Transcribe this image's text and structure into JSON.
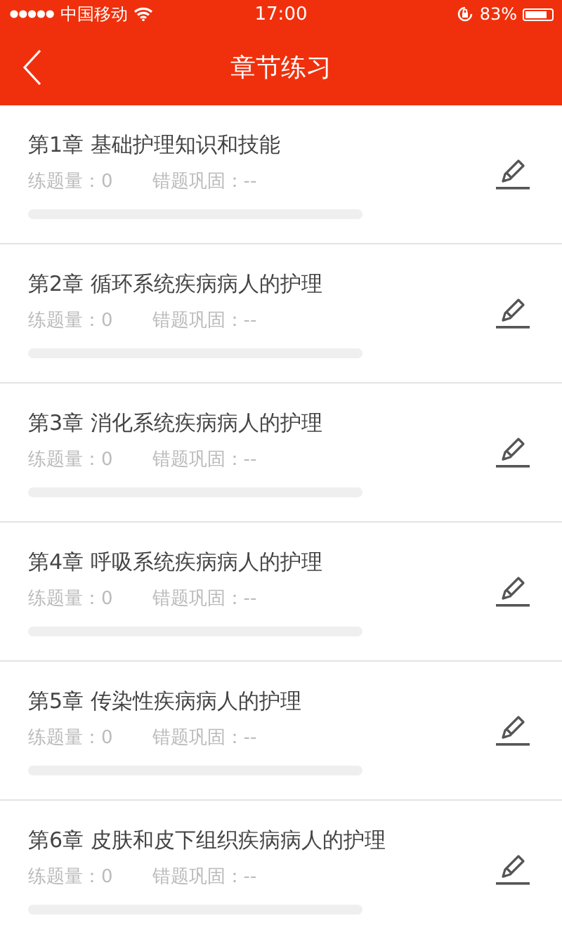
{
  "status_bar": {
    "carrier": "中国移动",
    "time": "17:00",
    "battery": "83%"
  },
  "nav": {
    "title": "章节练习"
  },
  "chapters": [
    {
      "title": "第1章 基础护理知识和技能",
      "count_label": "练题量：0",
      "review_label": "错题巩固：--",
      "level": 0
    },
    {
      "title": "第2章 循环系统疾病病人的护理",
      "count_label": "练题量：0",
      "review_label": "错题巩固：--",
      "level": 0
    },
    {
      "title": "第3章 消化系统疾病病人的护理",
      "count_label": "练题量：0",
      "review_label": "错题巩固：--",
      "level": 0
    },
    {
      "title": "第4章 呼吸系统疾病病人的护理",
      "count_label": "练题量：0",
      "review_label": "错题巩固：--",
      "level": 0
    },
    {
      "title": "第5章 传染性疾病病人的护理",
      "count_label": "练题量：0",
      "review_label": "错题巩固：--",
      "level": 0
    },
    {
      "title": "第6章 皮肤和皮下组织疾病病人的护理",
      "count_label": "练题量：0",
      "review_label": "错题巩固：--",
      "level": 0
    }
  ]
}
